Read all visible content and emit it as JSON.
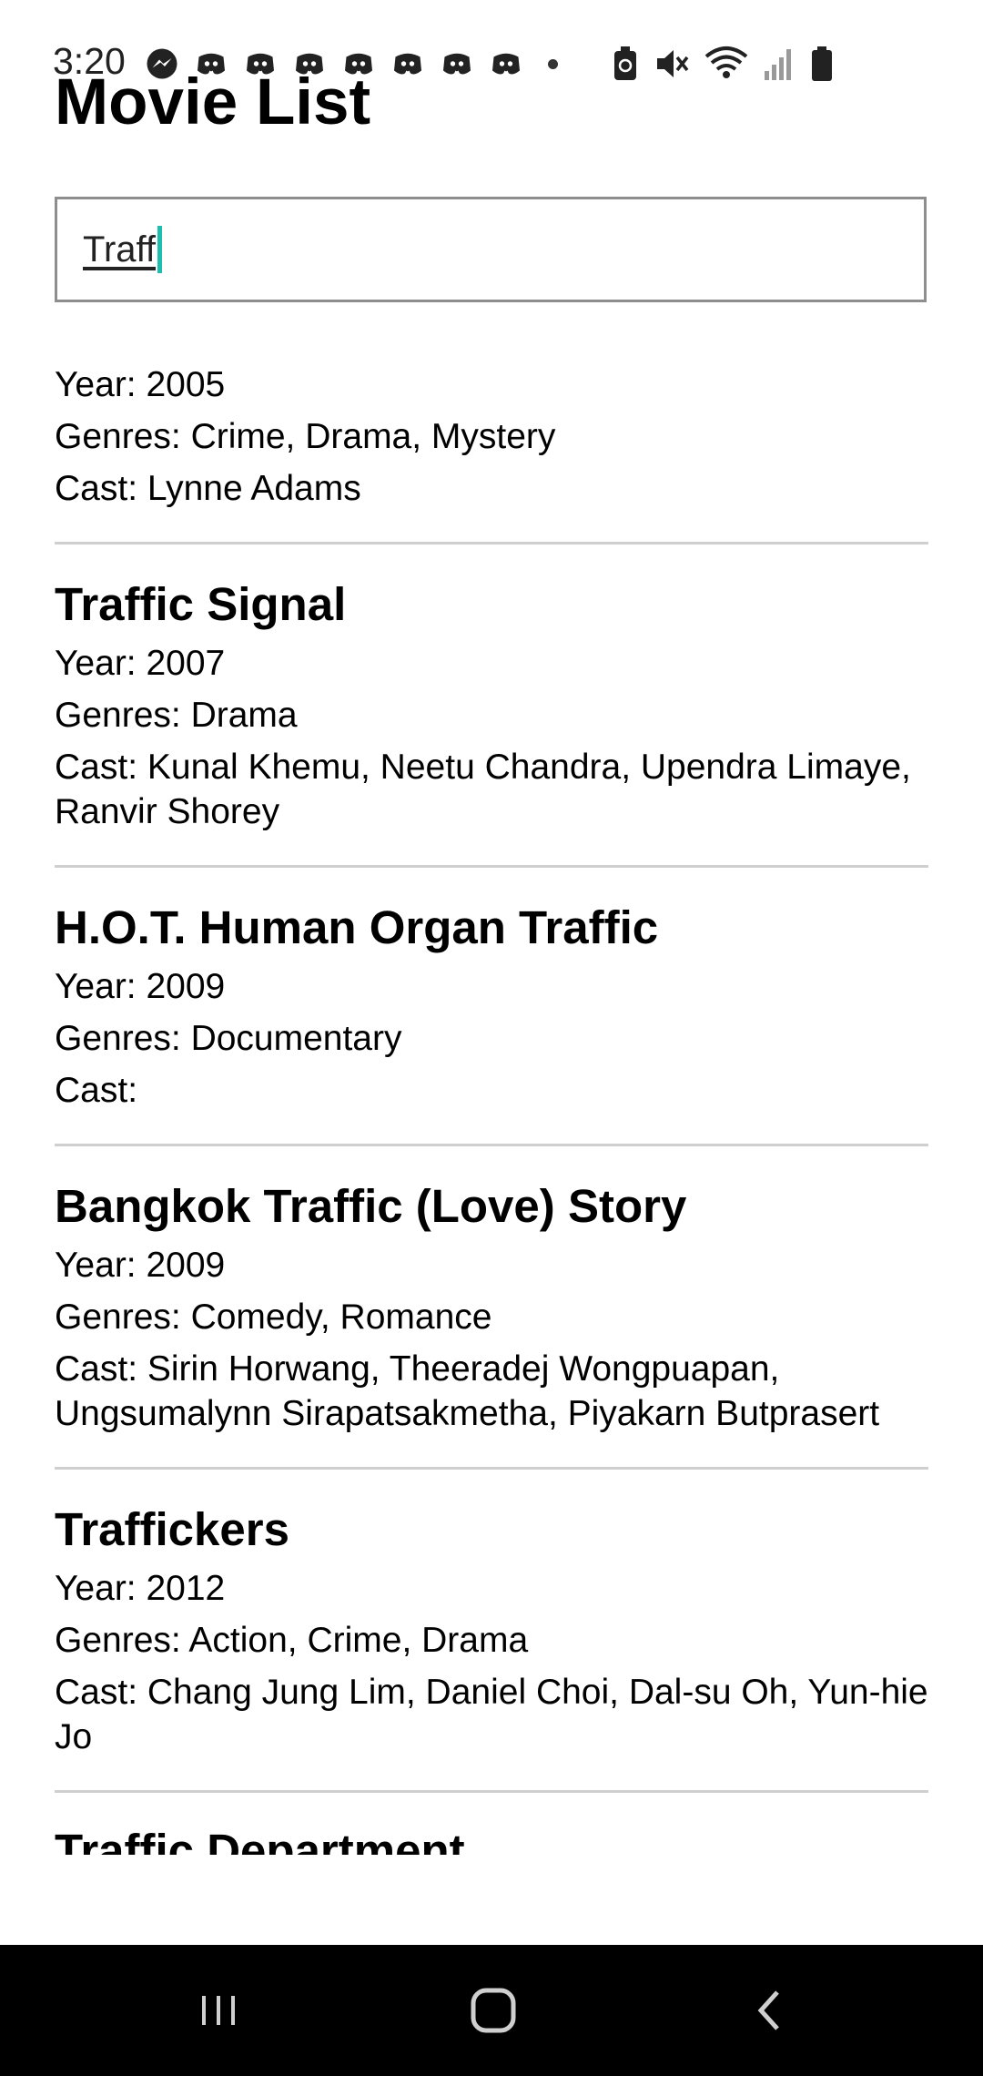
{
  "status_bar": {
    "time": "3:20",
    "notification_icons": [
      "messenger-icon",
      "discord-icon",
      "discord-icon",
      "discord-icon",
      "discord-icon",
      "discord-icon",
      "discord-icon",
      "discord-icon"
    ],
    "system_icons": [
      "battery-saver-icon",
      "mute-icon",
      "wifi-icon",
      "signal-icon",
      "battery-icon"
    ]
  },
  "page": {
    "title": "Movie List"
  },
  "search": {
    "value": "Traff"
  },
  "movies": [
    {
      "title": "",
      "year": "Year: 2005",
      "genres": "Genres: Crime, Drama, Mystery",
      "cast": "Cast: Lynne Adams"
    },
    {
      "title": "Traffic Signal",
      "year": "Year: 2007",
      "genres": "Genres: Drama",
      "cast": "Cast: Kunal Khemu, Neetu Chandra, Upendra Limaye, Ranvir Shorey"
    },
    {
      "title": "H.O.T. Human Organ Traffic",
      "year": "Year: 2009",
      "genres": "Genres: Documentary",
      "cast": "Cast:"
    },
    {
      "title": "Bangkok Traffic (Love) Story",
      "year": "Year: 2009",
      "genres": "Genres: Comedy, Romance",
      "cast": "Cast: Sirin Horwang, Theeradej Wongpuapan, Ungsumalynn Sirapatsakmetha, Piyakarn Butprasert"
    },
    {
      "title": "Traffickers",
      "year": "Year: 2012",
      "genres": "Genres: Action, Crime, Drama",
      "cast": "Cast: Chang Jung Lim, Daniel Choi, Dal-su Oh, Yun-hie Jo"
    },
    {
      "title": "Traffic Department"
    }
  ],
  "nav_bar": {
    "buttons": [
      "recent-apps-icon",
      "home-icon",
      "back-icon"
    ]
  }
}
